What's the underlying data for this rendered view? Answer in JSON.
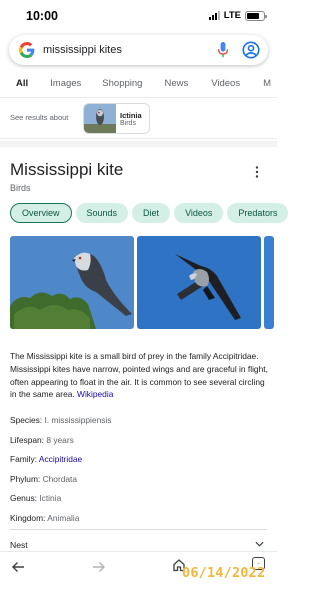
{
  "status_bar": {
    "time": "10:00",
    "network": "LTE"
  },
  "search": {
    "query": "mississippi kites"
  },
  "tabs": [
    {
      "label": "All",
      "active": true
    },
    {
      "label": "Images"
    },
    {
      "label": "Shopping"
    },
    {
      "label": "News"
    },
    {
      "label": "Videos"
    },
    {
      "label": "M"
    }
  ],
  "see_results": {
    "label": "See results about",
    "entity_title": "Ictinia",
    "entity_subtitle": "Birds"
  },
  "knowledge_panel": {
    "title": "Mississippi kite",
    "subtitle": "Birds",
    "tabs": [
      {
        "label": "Overview",
        "active": true
      },
      {
        "label": "Sounds"
      },
      {
        "label": "Diet"
      },
      {
        "label": "Videos"
      },
      {
        "label": "Predators"
      }
    ],
    "description": "The Mississippi kite is a small bird of prey in the family Accipitridae. Mississippi kites have narrow, pointed wings and are graceful in flight, often appearing to float in the air. It is common to see several circling in the same area.",
    "description_link": "Wikipedia",
    "facts": [
      {
        "key": "Species:",
        "value": "I. mississippiensis",
        "link": false
      },
      {
        "key": "Lifespan:",
        "value": "8 years",
        "link": false
      },
      {
        "key": "Family:",
        "value": "Accipitridae",
        "link": true
      },
      {
        "key": "Phylum:",
        "value": "Chordata",
        "link": false
      },
      {
        "key": "Genus:",
        "value": "Ictinia",
        "link": false
      },
      {
        "key": "Kingdom:",
        "value": "Animalia",
        "link": false
      }
    ],
    "nest_label": "Nest"
  },
  "bottom_nav": {
    "tabs_count": "···"
  },
  "date_stamp": "06/14/2022",
  "colors": {
    "chip_green": "#d4f0e6",
    "chip_text": "#0b5442",
    "link_blue": "#1a0dab",
    "stamp_orange": "#f2b640"
  }
}
